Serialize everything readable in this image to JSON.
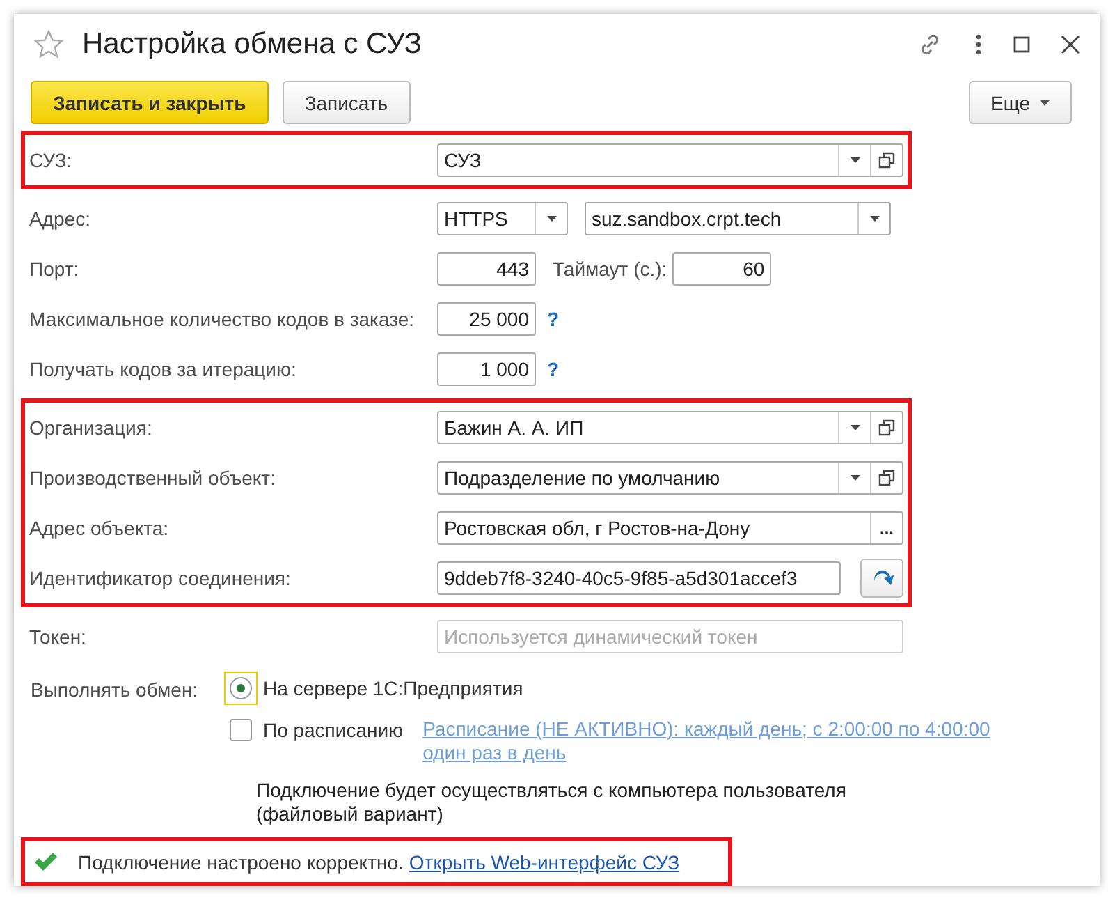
{
  "window": {
    "title": "Настройка обмена с СУЗ",
    "favorite": false
  },
  "toolbar": {
    "buttons": [
      {
        "label": "Записать и закрыть",
        "kind": "primary"
      },
      {
        "label": "Записать",
        "kind": "default"
      }
    ],
    "more": "Еще"
  },
  "sections": [
    {
      "highlighted": true,
      "rows": [
        {
          "label": "СУЗ:",
          "fields": [
            {
              "kind": "select",
              "value": "СУЗ",
              "open_button": true
            }
          ]
        }
      ]
    },
    {
      "highlighted": false,
      "rows": [
        {
          "label": "Адрес:",
          "fields": [
            {
              "kind": "select",
              "value": "HTTPS",
              "open_button": false
            },
            {
              "kind": "select",
              "value": "suz.sandbox.crpt.tech",
              "open_button": false
            }
          ]
        },
        {
          "label": "Порт:",
          "fields": [
            {
              "kind": "number",
              "value": "443"
            },
            {
              "kind": "label",
              "text": "Таймаут (с.):"
            },
            {
              "kind": "number",
              "value": "60"
            }
          ]
        },
        {
          "label": "Максимальное количество кодов в заказе:",
          "fields": [
            {
              "kind": "number",
              "value": "25 000",
              "help": "?"
            }
          ]
        },
        {
          "label": "Получать кодов за итерацию:",
          "fields": [
            {
              "kind": "number",
              "value": "1 000",
              "help": "?"
            }
          ]
        }
      ]
    },
    {
      "highlighted": true,
      "rows": [
        {
          "label": "Организация:",
          "fields": [
            {
              "kind": "select",
              "value": "Бажин А. А. ИП",
              "open_button": true
            }
          ]
        },
        {
          "label": "Производственный объект:",
          "fields": [
            {
              "kind": "select",
              "value": "Подразделение по умолчанию",
              "open_button": true
            }
          ]
        },
        {
          "label": "Адрес объекта:",
          "fields": [
            {
              "kind": "text",
              "value": "Ростовская обл, г Ростов-на-Дону",
              "choice": "..."
            }
          ]
        },
        {
          "label": "Идентификатор соединения:",
          "fields": [
            {
              "kind": "text",
              "value": "9ddeb7f8-3240-40c5-9f85-a5d301accef3",
              "action": true
            }
          ]
        }
      ]
    },
    {
      "highlighted": false,
      "rows": [
        {
          "label": "Токен:",
          "fields": [
            {
              "kind": "text",
              "placeholder": "Используется динамический токен",
              "disabled": true
            }
          ]
        }
      ]
    }
  ],
  "exchange": {
    "label": "Выполнять обмен:",
    "options": [
      {
        "kind": "radio",
        "label": "На сервере 1С:Предприятия",
        "selected": true,
        "focused": true
      },
      {
        "kind": "checkbox",
        "label": "По расписанию",
        "checked": false,
        "focused": false,
        "link": "Расписание (НЕ АКТИВНО): каждый день; с 2:00:00 по 4:00:00\nодин раз в день"
      }
    ],
    "note": "Подключение будет осуществляться с компьютера пользователя\n(файловый вариант)"
  },
  "status": {
    "ok": true,
    "highlighted": true,
    "text": "Подключение настроено корректно.",
    "link": "Открыть Web-интерфейс СУЗ"
  }
}
